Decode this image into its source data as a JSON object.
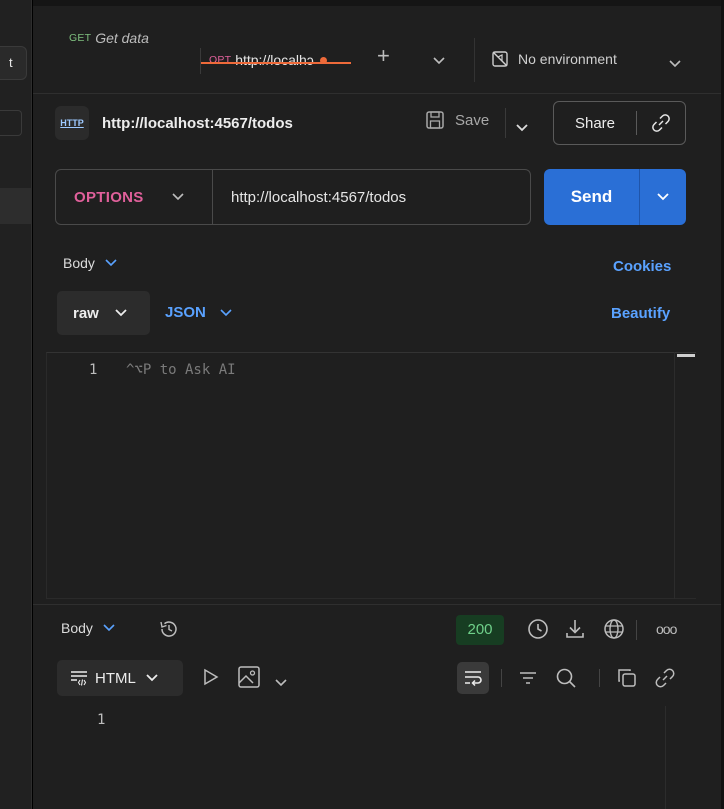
{
  "left_panel": {
    "tab_fragment": "t"
  },
  "tabs": [
    {
      "method": "GET",
      "label": "Get data"
    },
    {
      "method": "OPT",
      "label": "http://localhɔ"
    }
  ],
  "environment": {
    "label": "No environment"
  },
  "request": {
    "badge": "HTTP",
    "title": "http://localhost:4567/todos",
    "save_label": "Save",
    "share_label": "Share",
    "method": "OPTIONS",
    "url": "http://localhost:4567/todos",
    "send_label": "Send"
  },
  "request_body": {
    "tab_label": "Body",
    "cookies_label": "Cookies",
    "mode": "raw",
    "language": "JSON",
    "beautify_label": "Beautify",
    "line_number": "1",
    "placeholder": "^⌥P to Ask AI"
  },
  "response": {
    "tab_label": "Body",
    "status_code": "200",
    "more_label": "ooo",
    "format": "HTML",
    "line_number": "1"
  },
  "colors": {
    "accent_blue": "#2a6fd6",
    "link_blue": "#5aa2ff",
    "method_options": "#e0609b",
    "unsaved_dot": "#ee6a3a",
    "status_ok_bg": "#173d22",
    "status_ok_text": "#6fd08a"
  }
}
